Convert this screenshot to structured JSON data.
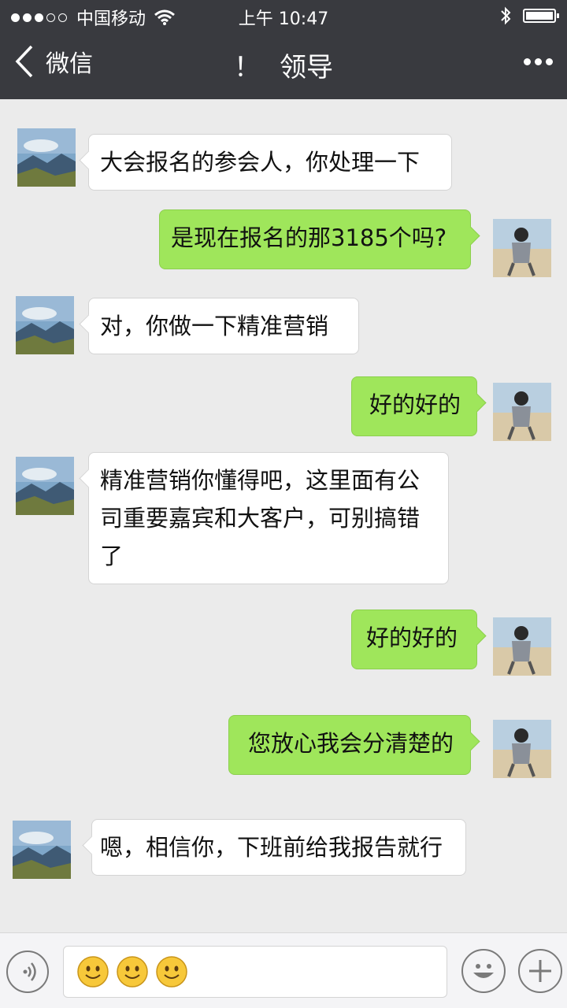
{
  "status_bar": {
    "signal": "●●●○○",
    "carrier": "中国移动",
    "time": "上午 10:47",
    "icons": [
      "wifi-icon",
      "bluetooth-icon",
      "battery-icon"
    ]
  },
  "nav": {
    "back_label": "微信",
    "title_mark": "！",
    "title": "领导",
    "more_icon": "more-dots-icon"
  },
  "messages": [
    {
      "side": "in",
      "text": "大会报名的参会人，你处理一下"
    },
    {
      "side": "out",
      "text": "是现在报名的那3185个吗?"
    },
    {
      "side": "in",
      "text": "对，你做一下精准营销"
    },
    {
      "side": "out",
      "text": "好的好的"
    },
    {
      "side": "in",
      "text_lines": [
        "精准营销你懂得吧，这里面有公",
        "司重要嘉宾和大客户，可别搞错",
        "了"
      ]
    },
    {
      "side": "out",
      "text": "好的好的"
    },
    {
      "side": "out",
      "text": "您放心我会分清楚的"
    },
    {
      "side": "in",
      "text": "嗯，相信你，下班前给我报告就行"
    }
  ],
  "input_bar": {
    "voice_icon": "voice-icon",
    "emojis": [
      "smiley-icon",
      "smiley-icon",
      "smiley-icon"
    ],
    "emoji_icon": "emoji-face-icon",
    "plus_icon": "plus-icon"
  },
  "colors": {
    "header_bg": "#393a3f",
    "chat_bg": "#ebebeb",
    "outgoing_bubble": "#9fe65b",
    "incoming_bubble": "#ffffff"
  }
}
